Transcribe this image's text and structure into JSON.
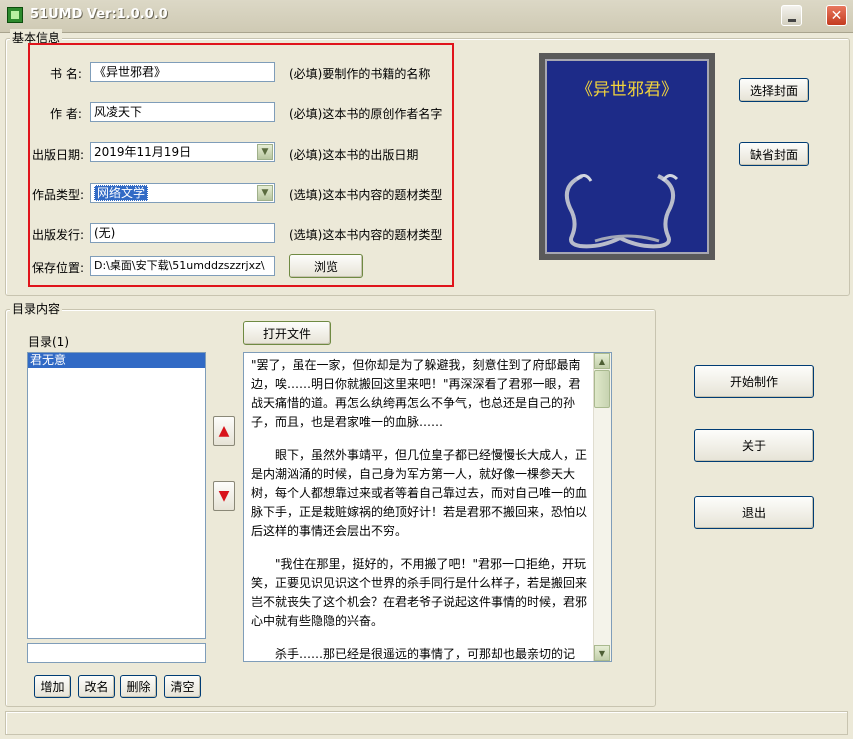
{
  "window": {
    "title": "51UMD Ver:1.0.0.0"
  },
  "basic_info": {
    "legend": "基本信息",
    "fields": {
      "name": {
        "label": "书  名:",
        "value": "《异世邪君》",
        "hint": "(必填)要制作的书籍的名称"
      },
      "author": {
        "label": "作  者:",
        "value": "风凌天下",
        "hint": "(必填)这本书的原创作者名字"
      },
      "date": {
        "label": "出版日期:",
        "value": "2019年11月19日",
        "hint": "(必填)这本书的出版日期"
      },
      "genre": {
        "label": "作品类型:",
        "value": "网络文学",
        "hint": "(选填)这本书内容的题材类型"
      },
      "publisher": {
        "label": "出版发行:",
        "value": "(无)",
        "hint": "(选填)这本书内容的题材类型"
      },
      "save": {
        "label": "保存位置:",
        "value": "D:\\桌面\\安下载\\51umddzszzrjxz\\"
      }
    },
    "browse_button": "浏览",
    "cover_title": "《异世邪君》",
    "select_cover_button": "选择封面",
    "default_cover_button": "缺省封面"
  },
  "toc": {
    "legend": "目录内容",
    "list_label": "目录(1)",
    "items": [
      "君无意"
    ],
    "rename_input_value": "",
    "open_file_button": "打开文件",
    "add_button": "增加",
    "rename_button": "改名",
    "delete_button": "删除",
    "clear_button": "清空",
    "content_paragraphs": [
      "\"罢了，虽在一家，但你却是为了躲避我，刻意住到了府邸最南边，唉……明日你就搬回这里来吧！\"再深深看了君邪一眼，君战天痛惜的道。再怎么纨绔再怎么不争气，也总还是自己的孙子，而且，也是君家唯一的血脉……",
      "　　眼下，虽然外事靖平，但几位皇子都已经慢慢长大成人，正是内潮汹涌的时候，自己身为军方第一人，就好像一棵参天大树，每个人都想靠过来或者等着自己靠过去，而对自己唯一的血脉下手，正是栽赃嫁祸的绝顶好计！若是君邪不搬回来，恐怕以后这样的事情还会层出不穷。",
      "　　\"我住在那里，挺好的，不用搬了吧！\"君邪一口拒绝，开玩笑，正要见识见识这个世界的杀手同行是什么样子，若是搬回来岂不就丧失了这个机会？在君老爷子说起这件事情的时候，君邪心中就有些隐隐的兴奋。",
      "　　杀手……那已经是很遥远的事情了，可那却也最亲切的记忆……"
    ]
  },
  "actions": {
    "start_button": "开始制作",
    "about_button": "关于",
    "exit_button": "退出"
  },
  "status_bar": {
    "text": ""
  }
}
